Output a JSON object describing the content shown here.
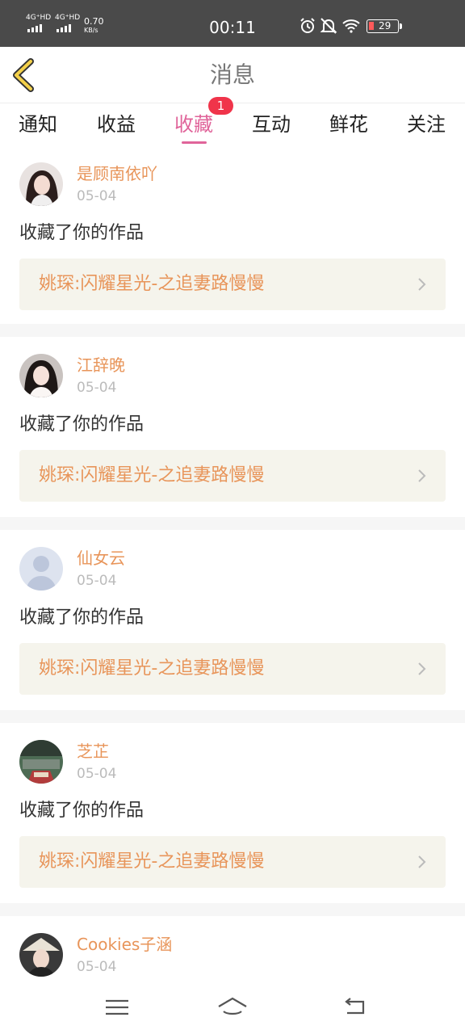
{
  "status_bar": {
    "net1": "4G⁺HD",
    "net2": "4G⁺HD",
    "speed": "0.70",
    "speed_unit": "KB/s",
    "time": "00:11",
    "battery": "29"
  },
  "header": {
    "title": "消息"
  },
  "tabs": [
    {
      "label": "通知"
    },
    {
      "label": "收益"
    },
    {
      "label": "收藏",
      "badge": "1"
    },
    {
      "label": "互动"
    },
    {
      "label": "鲜花"
    },
    {
      "label": "关注"
    }
  ],
  "active_tab": "收藏",
  "colors": {
    "accent": "#e0649a",
    "username": "#e8955a",
    "badge": "#f0344a",
    "link_bg": "#f5f4ec"
  },
  "feed": [
    {
      "user": "是顾南依吖",
      "date": "05-04",
      "action": "收藏了你的作品",
      "work": "姚琛:闪耀星光-之追妻路慢慢"
    },
    {
      "user": "江辞晚",
      "date": "05-04",
      "action": "收藏了你的作品",
      "work": "姚琛:闪耀星光-之追妻路慢慢"
    },
    {
      "user": "仙女云",
      "date": "05-04",
      "action": "收藏了你的作品",
      "work": "姚琛:闪耀星光-之追妻路慢慢"
    },
    {
      "user": "芝芷",
      "date": "05-04",
      "action": "收藏了你的作品",
      "work": "姚琛:闪耀星光-之追妻路慢慢"
    },
    {
      "user": "Cookies子涵",
      "date": "05-04"
    }
  ]
}
